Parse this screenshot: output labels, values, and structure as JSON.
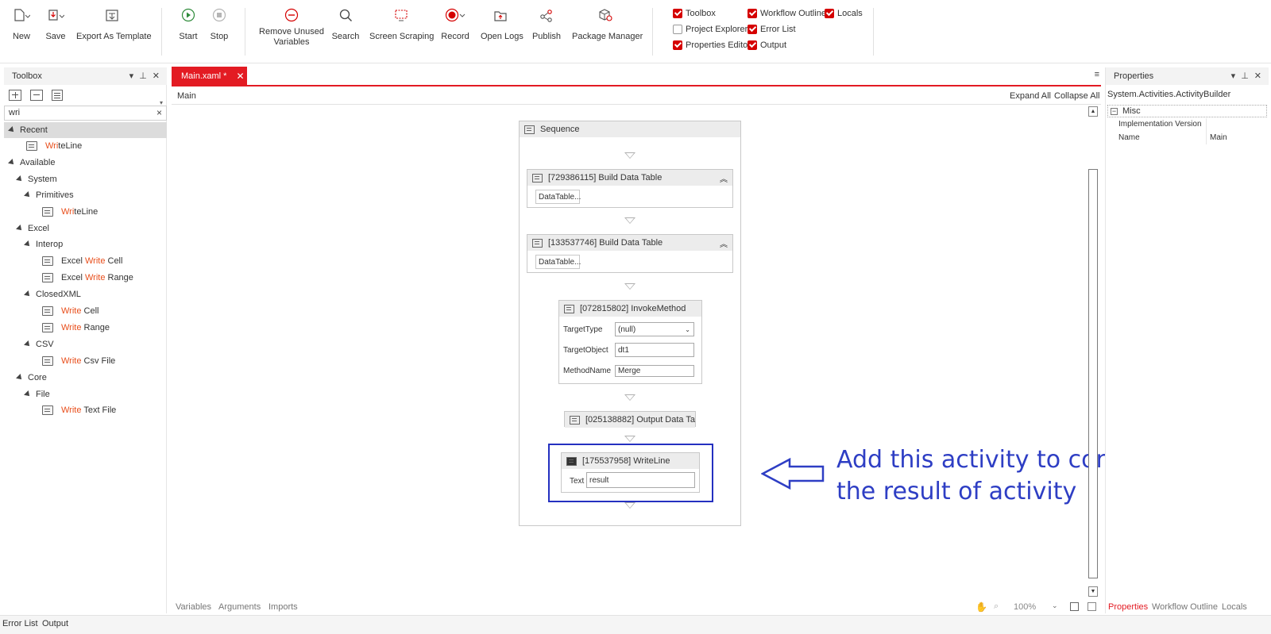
{
  "ribbon": {
    "new": "New",
    "save": "Save",
    "export_template": "Export As Template",
    "start": "Start",
    "stop": "Stop",
    "remove_unused_1": "Remove Unused",
    "remove_unused_2": "Variables",
    "search": "Search",
    "screen_scraping": "Screen Scraping",
    "record": "Record",
    "open_logs": "Open Logs",
    "publish": "Publish",
    "package_manager": "Package Manager",
    "panels": [
      {
        "label": "Toolbox",
        "checked": true
      },
      {
        "label": "Workflow Outline",
        "checked": true
      },
      {
        "label": "Locals",
        "checked": true
      },
      {
        "label": "Project Explorer",
        "checked": false
      },
      {
        "label": "Error List",
        "checked": true
      },
      {
        "label": "Properties Editor",
        "checked": true
      },
      {
        "label": "Output",
        "checked": true
      }
    ],
    "accent": "#d50000"
  },
  "toolbox": {
    "title": "Toolbox",
    "search_value": "wri",
    "clear": "×",
    "recent": "Recent",
    "available": "Available",
    "system": "System",
    "primitives": "Primitives",
    "excel": "Excel",
    "interop": "Interop",
    "closedxml": "ClosedXML",
    "csv": "CSV",
    "core": "Core",
    "file": "File",
    "hl": "Write",
    "hl_lower": "Write",
    "writeline_hl": "Wri",
    "writeline_rest": "teLine",
    "excel_write_cell_pre": "Excel ",
    "cell_suffix": " Cell",
    "range_suffix": " Range",
    "csv_suffix": " Csv File",
    "text_file_suffix": " Text File"
  },
  "document": {
    "tab_label": "Main.xaml *",
    "breadcrumb": "Main",
    "expand_all": "Expand All",
    "collapse_all": "Collapse All"
  },
  "workflow": {
    "sequence": "Sequence",
    "build1": "[729386115] Build Data Table",
    "build2": "[133537746] Build Data Table",
    "datatable_btn": "DataTable...",
    "invoke": "[072815802] InvokeMethod",
    "target_type_label": "TargetType",
    "target_type_value": "(null)",
    "target_object_label": "TargetObject",
    "target_object_value": "dt1",
    "method_name_label": "MethodName",
    "method_name_value": "Merge",
    "output_dt": "[025138882] Output Data Ta",
    "writeline": "[175537958] WriteLine",
    "text_label": "Text",
    "text_value": "result"
  },
  "annotation": {
    "line1": "Add this activity to confirm",
    "line2": "the result of activity",
    "color": "#2e3ec4"
  },
  "designer_bottom": {
    "variables": "Variables",
    "arguments": "Arguments",
    "imports": "Imports",
    "zoom": "100%"
  },
  "properties": {
    "title": "Properties",
    "type": "System.Activities.ActivityBuilder",
    "misc": "Misc",
    "impl_version": "Implementation Version",
    "name_label": "Name",
    "name_value": "Main",
    "tabs": [
      "Properties",
      "Workflow Outline",
      "Locals"
    ]
  },
  "status_bar": {
    "error_list": "Error List",
    "output": "Output"
  }
}
